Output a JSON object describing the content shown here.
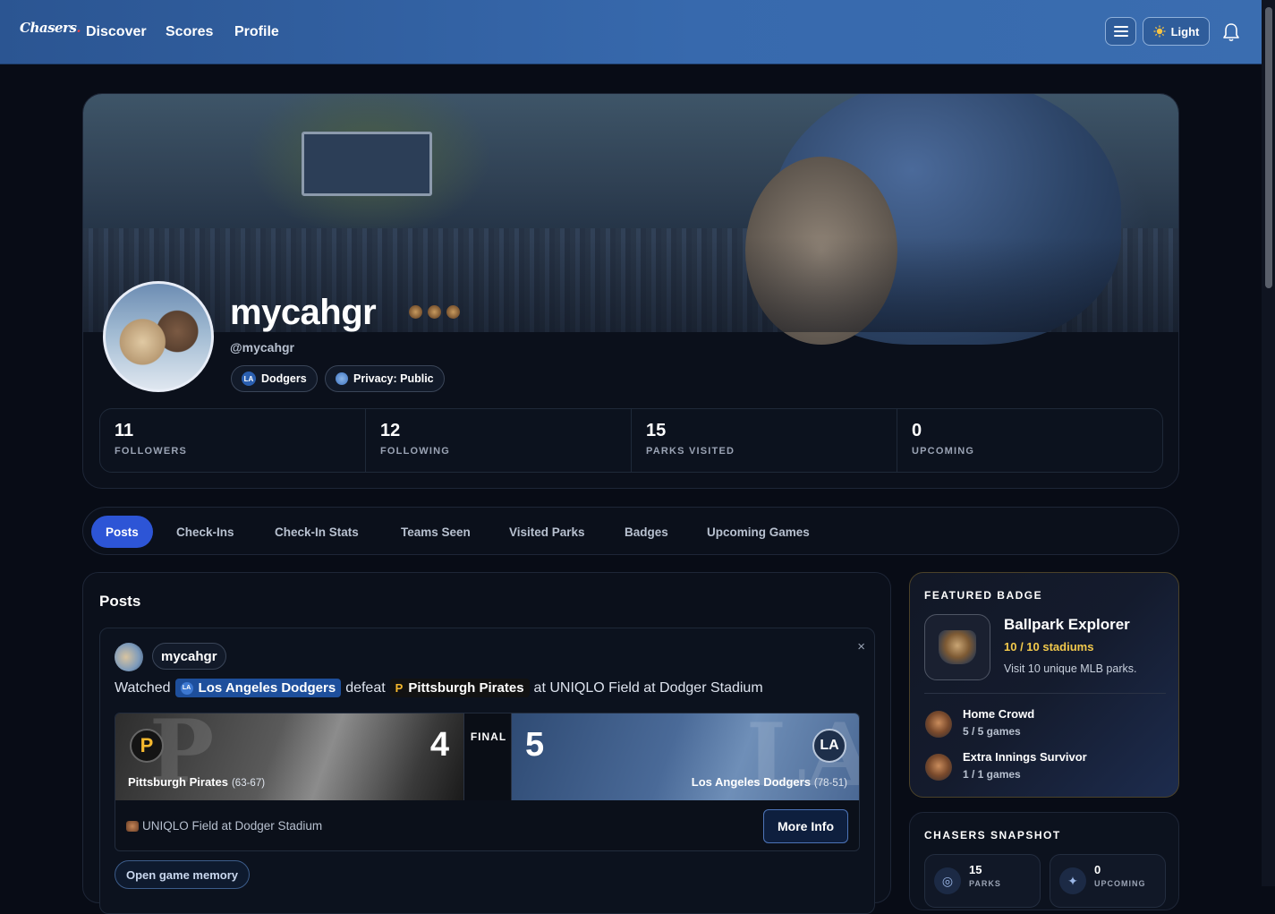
{
  "nav": {
    "logo": "Chasers",
    "links": [
      "Discover",
      "Scores",
      "Profile"
    ],
    "theme_label": "Light",
    "icons": {
      "menu": "hamburger-icon",
      "theme": "sun-icon",
      "notifications": "bell-icon"
    }
  },
  "profile": {
    "username": "mycahgr",
    "handle": "@mycahgr",
    "team_pill": "Dodgers",
    "privacy_pill": "Privacy: Public",
    "stats": [
      {
        "value": "11",
        "label": "FOLLOWERS"
      },
      {
        "value": "12",
        "label": "FOLLOWING"
      },
      {
        "value": "15",
        "label": "PARKS VISITED"
      },
      {
        "value": "0",
        "label": "UPCOMING"
      }
    ]
  },
  "tabs": [
    "Posts",
    "Check-Ins",
    "Check-In Stats",
    "Teams Seen",
    "Visited Parks",
    "Badges",
    "Upcoming Games"
  ],
  "active_tab": "Posts",
  "posts": {
    "title": "Posts",
    "post": {
      "user": "mycahgr",
      "close": "×",
      "prefix": "Watched",
      "winner": "Los Angeles Dodgers",
      "verb": "defeat",
      "loser": "Pittsburgh Pirates",
      "suffix": "at UNIQLO Field at Dodger Stadium",
      "game": {
        "status": "FINAL",
        "away": {
          "name": "Pittsburgh Pirates",
          "record": "(63-67)",
          "score": "4",
          "logo_letter": "P"
        },
        "home": {
          "name": "Los Angeles Dodgers",
          "record": "(78-51)",
          "score": "5",
          "logo_letter": "LA"
        },
        "venue": "UNIQLO Field at Dodger Stadium",
        "more_info": "More Info"
      },
      "memory_button": "Open game memory"
    }
  },
  "featured": {
    "title": "FEATURED BADGE",
    "name": "Ballpark Explorer",
    "progress": "10 / 10 stadiums",
    "description": "Visit 10 unique MLB parks.",
    "others": [
      {
        "name": "Home Crowd",
        "progress": "5 / 5 games"
      },
      {
        "name": "Extra Innings Survivor",
        "progress": "1 / 1 games"
      }
    ]
  },
  "snapshot": {
    "title": "CHASERS SNAPSHOT",
    "cards": [
      {
        "value": "15",
        "label": "PARKS",
        "icon": "target-icon"
      },
      {
        "value": "0",
        "label": "UPCOMING",
        "icon": "sparkle-icon"
      }
    ]
  },
  "colors": {
    "accent": "#2d55d6",
    "nav": "#3769ad",
    "gold": "#f2c94c",
    "background": "#080c16"
  }
}
